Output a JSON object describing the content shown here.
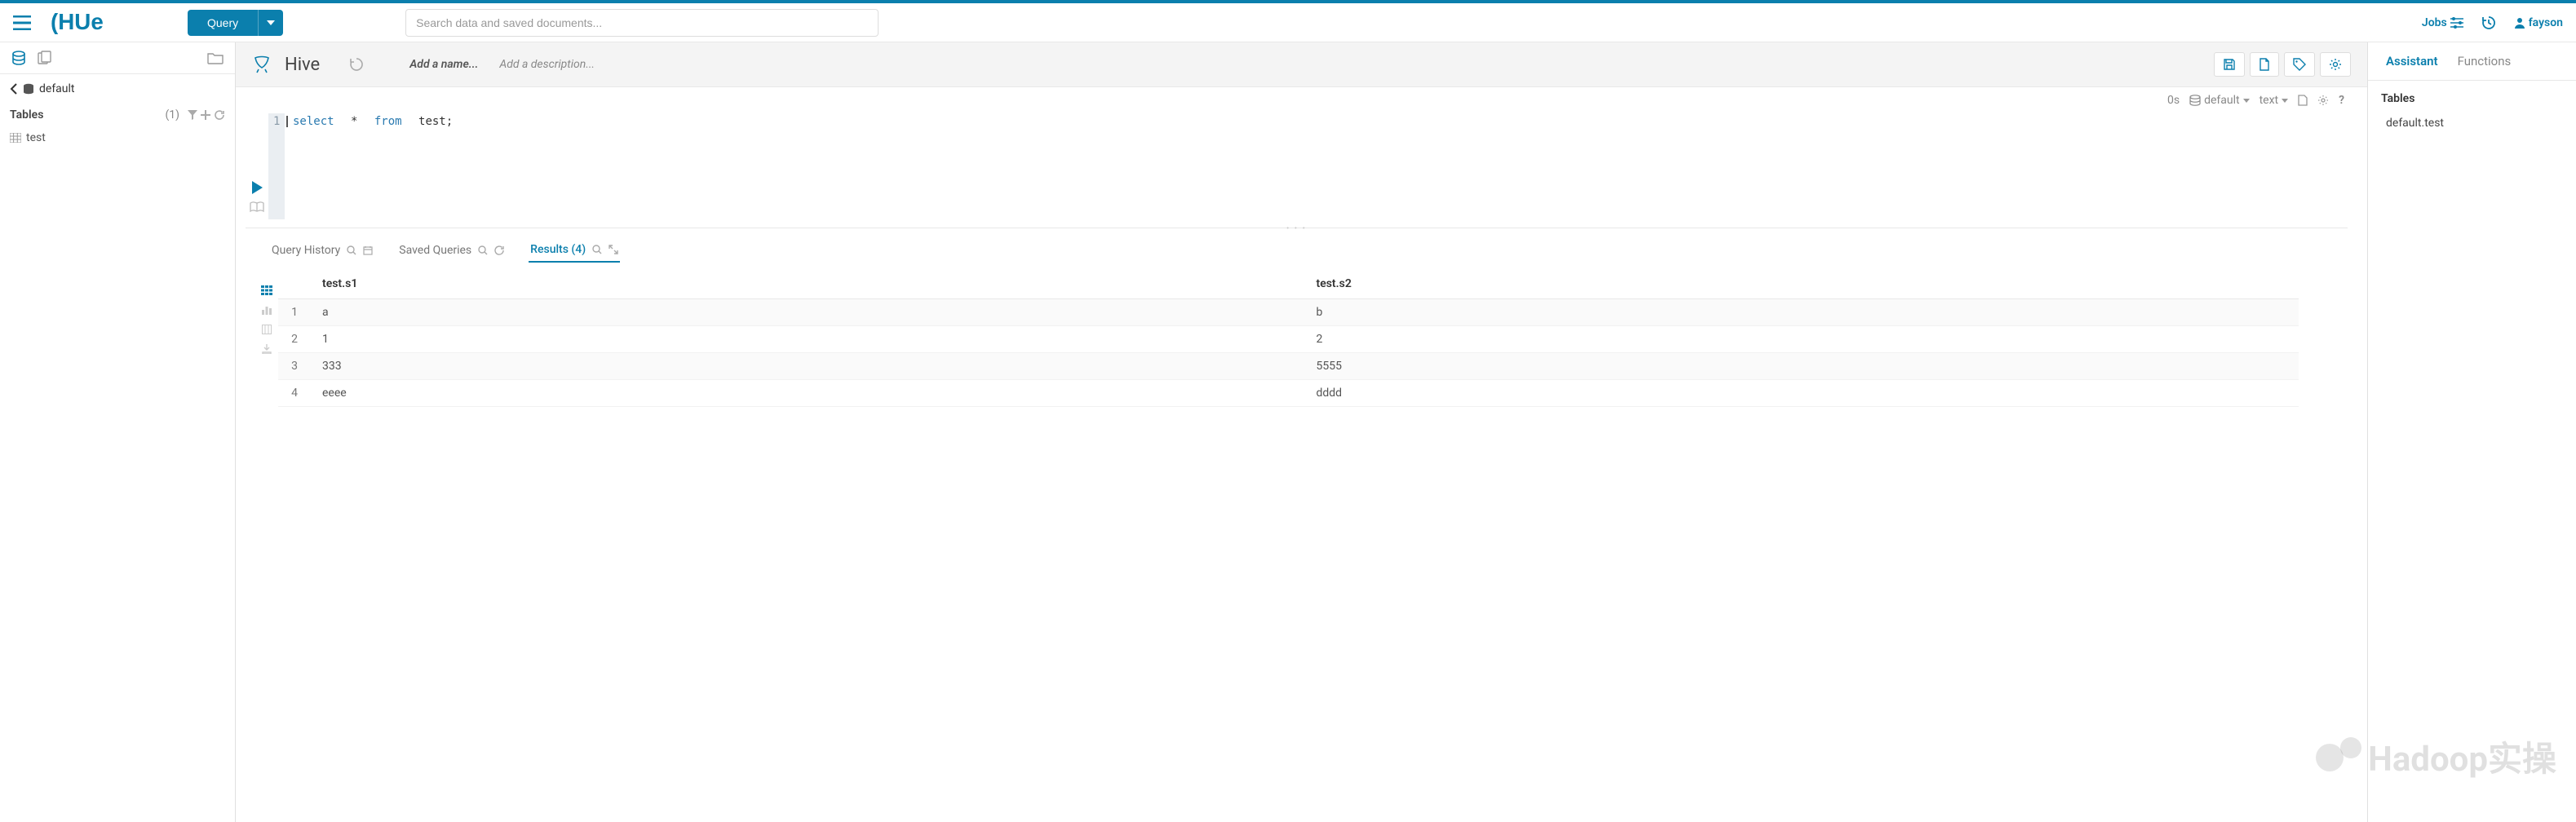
{
  "header": {
    "logo_text": "Hue",
    "query_label": "Query",
    "search_placeholder": "Search data and saved documents...",
    "jobs_label": "Jobs",
    "user_name": "fayson"
  },
  "left": {
    "breadcrumb": "default",
    "tables_label": "Tables",
    "tables_count": "(1)",
    "items": [
      {
        "name": "test"
      }
    ]
  },
  "editor": {
    "engine": "Hive",
    "name_placeholder": "Add a name...",
    "desc_placeholder": "Add a description...",
    "toolbar": {
      "duration": "0s",
      "db": "default",
      "mode": "text"
    },
    "code_line_num": "1",
    "code": {
      "kw1": "select",
      "star": " * ",
      "kw2": "from",
      "rest": " test;"
    }
  },
  "tabs": {
    "history": "Query History",
    "saved": "Saved Queries",
    "results": "Results (4)"
  },
  "results": {
    "columns": [
      "",
      "test.s1",
      "test.s2"
    ],
    "rows": [
      {
        "n": "1",
        "s1": "a",
        "s2": "b"
      },
      {
        "n": "2",
        "s1": "1",
        "s2": "2"
      },
      {
        "n": "3",
        "s1": "333",
        "s2": "5555"
      },
      {
        "n": "4",
        "s1": "eeee",
        "s2": "dddd"
      }
    ]
  },
  "right": {
    "tab_assistant": "Assistant",
    "tab_functions": "Functions",
    "heading": "Tables",
    "entry": "default.test"
  },
  "watermark": "Hadoop实操"
}
